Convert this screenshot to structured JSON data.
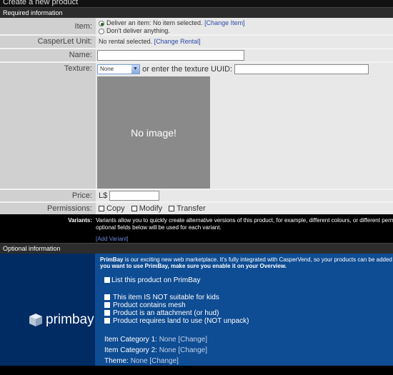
{
  "page_title": "Create a new product",
  "required_header": "Required information",
  "item": {
    "label": "Item:",
    "option_deliver": "Deliver an item: No item selected.",
    "change_item": "[Change Item]",
    "option_none": "Don't deliver anything."
  },
  "unit": {
    "label": "CasperLet Unit:",
    "value": "No rental selected.",
    "change_rental": "[Change Rental]"
  },
  "name": {
    "label": "Name:"
  },
  "texture": {
    "label": "Texture:",
    "select_value": "None",
    "or_text": "or enter the texture UUID:",
    "no_image": "No image!"
  },
  "price": {
    "label": "Price:",
    "currency": "L$"
  },
  "permissions": {
    "label": "Permissions:",
    "copy": "Copy",
    "modify": "Modify",
    "transfer": "Transfer"
  },
  "variants": {
    "label": "Variants:",
    "line1": "Variants allow you to quickly create alternative versions of this product, for example, different colours, or different permissi",
    "line2": "optional fields below will be used for each variant.",
    "add_variant": "[Add Variant]"
  },
  "optional_header": "Optional information",
  "primbay": {
    "logo_text": "primbay",
    "intro_bold": "PrimBay",
    "intro_rest": " is our exciting new web marketplace. It's fully integrated with CasperVend, so your products can be added to P",
    "intro_line2": "you want to use PrimBay, make sure you enable it on your Overview.",
    "list_option": "List this product on PrimBay",
    "options": [
      "This item IS NOT suitable for kids",
      "Product contains mesh",
      "Product is an attachment (or hud)",
      "Product requires land to use (NOT unpack)"
    ],
    "categories": [
      {
        "label": "Item Category 1: ",
        "value": "None",
        "change": " [Change]"
      },
      {
        "label": "Item Category 2: ",
        "value": "None",
        "change": " [Change]"
      },
      {
        "label": "Theme: ",
        "value": "None",
        "change": " [Change]"
      }
    ]
  },
  "colors": {
    "primbay_left": "#002b63",
    "primbay_right": "#0e4c93",
    "label_bg": "#d0d0d0",
    "value_bg": "#e8e8e8",
    "link": "#2b4aa8"
  }
}
